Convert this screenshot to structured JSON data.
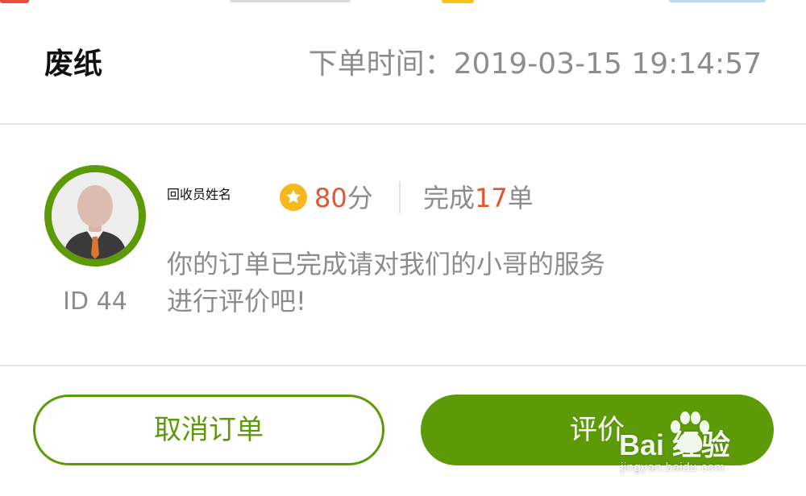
{
  "order": {
    "type": "废纸",
    "time_label": "下单时间：",
    "time_value": "2019-03-15 19:14:57"
  },
  "collector": {
    "name": "回收员姓名",
    "id_text": "ID 44",
    "rating_value": "80",
    "rating_unit": "分",
    "completed_prefix": "完成",
    "completed_count": "17",
    "completed_suffix": "单",
    "message_line1": "你的订单已完成请对我们的小哥的服务",
    "message_line2": "进行评价吧!"
  },
  "actions": {
    "cancel_label": "取消订单",
    "rate_label": "评价"
  },
  "watermark": {
    "brand": "Bai  经验",
    "url": "jingyan.baidu.com"
  },
  "icons": {
    "rating": "star-icon",
    "avatar": "user-avatar-icon"
  },
  "colors": {
    "brand_green": "#5c9a08",
    "accent_orange": "#e4572e",
    "star_yellow": "#f6b81d",
    "muted_text": "#8c8c8c"
  }
}
